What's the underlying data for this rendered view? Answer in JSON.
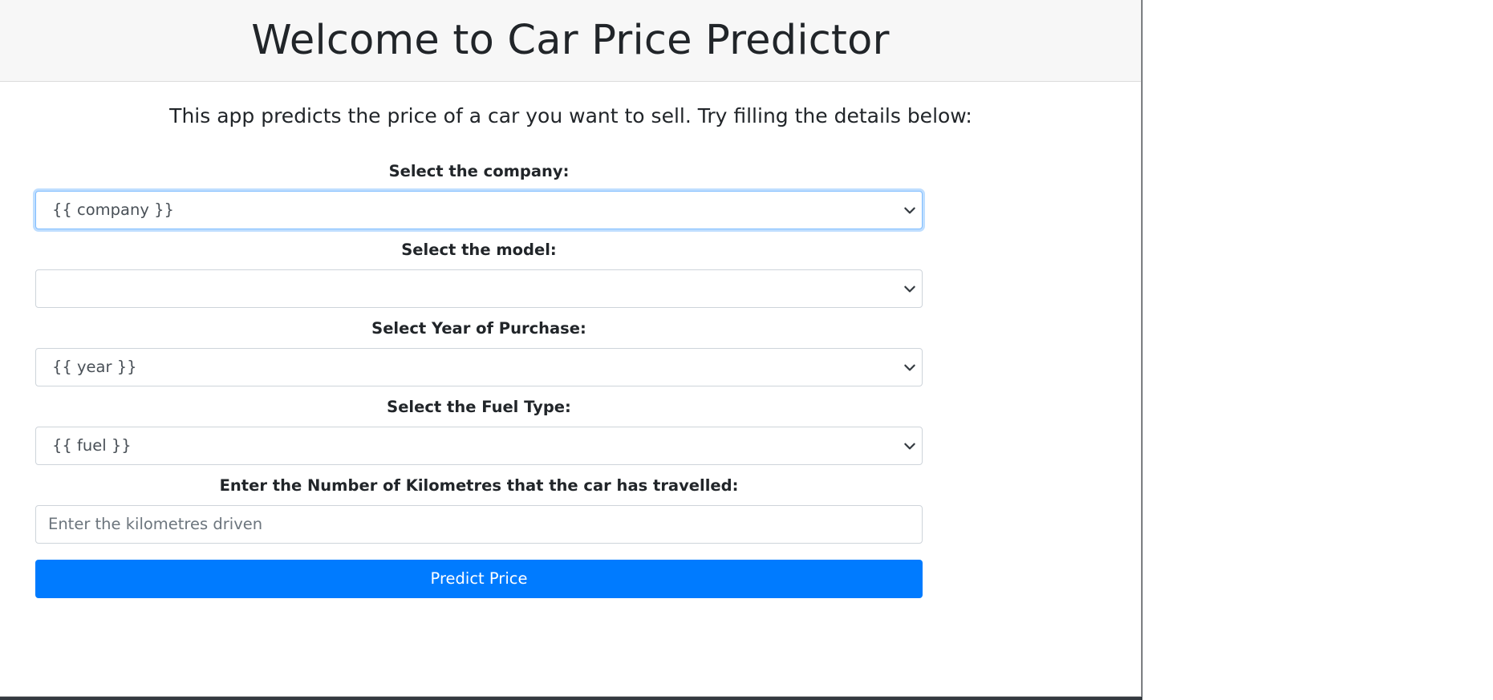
{
  "header": {
    "title": "Welcome to Car Price Predictor"
  },
  "intro": {
    "text": "This app predicts the price of a car you want to sell. Try filling the details below:"
  },
  "form": {
    "company": {
      "label": "Select the company:",
      "value": "{{ company }}"
    },
    "model": {
      "label": "Select the model:",
      "value": ""
    },
    "year": {
      "label": "Select Year of Purchase:",
      "value": "{{ year }}"
    },
    "fuel": {
      "label": "Select the Fuel Type:",
      "value": "{{ fuel }}"
    },
    "kilometres": {
      "label": "Enter the Number of Kilometres that the car has travelled:",
      "placeholder": "Enter the kilometres driven",
      "value": ""
    },
    "submit_label": "Predict Price"
  },
  "icons": {
    "select_arrow": "chevron-down-icon"
  },
  "colors": {
    "primary": "#007bff",
    "header_bg": "#f7f7f7",
    "focus_ring": "#80bdff"
  }
}
